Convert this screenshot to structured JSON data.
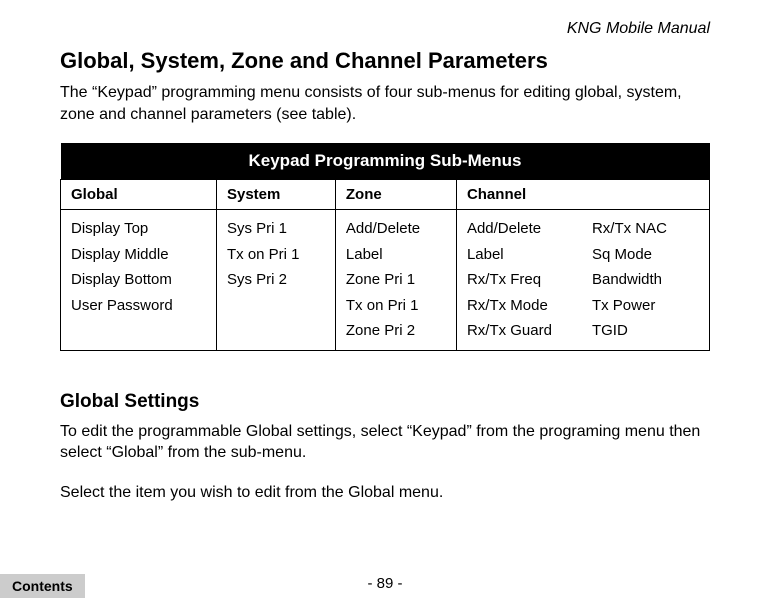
{
  "header": {
    "manual_title": "KNG Mobile Manual"
  },
  "section1": {
    "title": "Global, System, Zone and Channel Parameters",
    "para": "The “Keypad” programming menu consists of four sub-menus for editing global, system, zone and channel parameters (see table)."
  },
  "table": {
    "title": "Keypad Programming Sub-Menus",
    "headers": {
      "c1": "Global",
      "c2": "System",
      "c3": "Zone",
      "c4": "Channel"
    },
    "global": [
      "Display Top",
      "Display Middle",
      "Display Bottom",
      "User Password"
    ],
    "system": [
      "Sys Pri 1",
      "Tx on Pri 1",
      "Sys Pri 2"
    ],
    "zone": [
      "Add/Delete",
      "Label",
      "Zone Pri 1",
      "Tx on Pri 1",
      "Zone Pri 2"
    ],
    "channel_a": [
      "Add/Delete",
      "Label",
      "Rx/Tx Freq",
      "Rx/Tx Mode",
      "Rx/Tx Guard"
    ],
    "channel_b": [
      "Rx/Tx NAC",
      "Sq Mode",
      "Bandwidth",
      "Tx Power",
      "TGID"
    ]
  },
  "section2": {
    "title": "Global Settings",
    "para1": "To edit the programmable Global settings, select “Keypad” from the programing menu then select “Global” from the sub-menu.",
    "para2": "Select the item you wish to edit from the Global menu."
  },
  "footer": {
    "page_number": "- 89 -",
    "contents_label": "Contents"
  }
}
